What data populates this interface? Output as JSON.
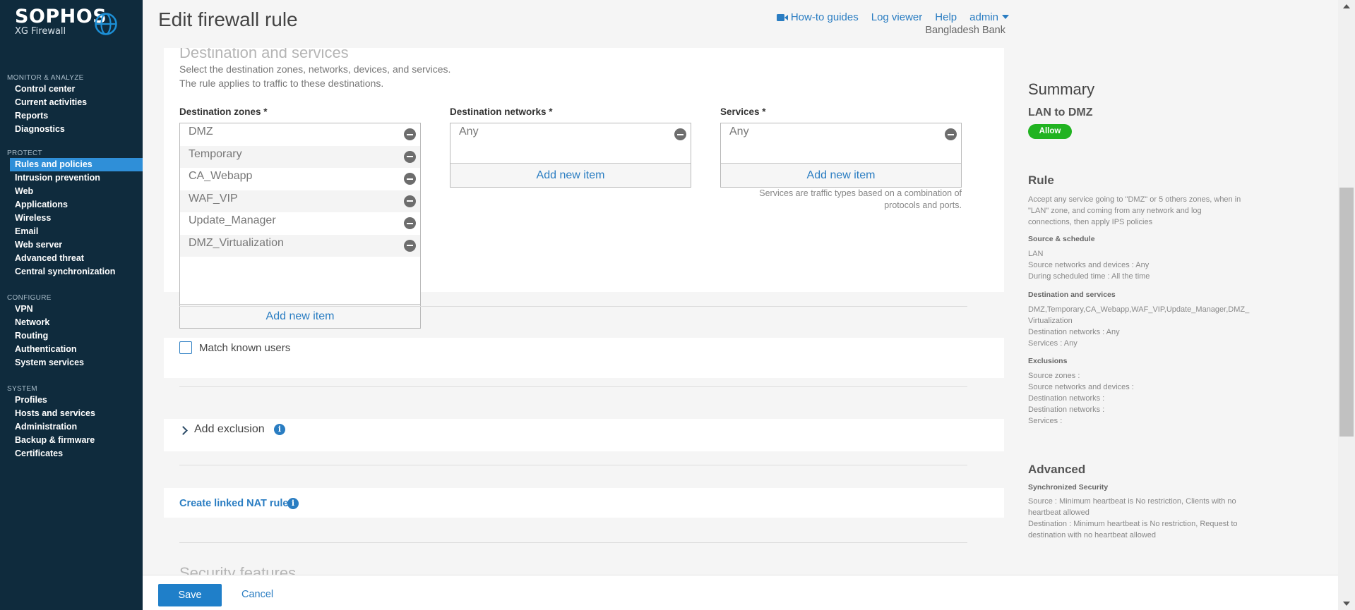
{
  "brand": {
    "name": "SOPHOS",
    "product": "XG Firewall"
  },
  "nav": [
    {
      "title": "MONITOR & ANALYZE",
      "items": [
        "Control center",
        "Current activities",
        "Reports",
        "Diagnostics"
      ]
    },
    {
      "title": "PROTECT",
      "items": [
        "Rules and policies",
        "Intrusion prevention",
        "Web",
        "Applications",
        "Wireless",
        "Email",
        "Web server",
        "Advanced threat",
        "Central synchronization"
      ]
    },
    {
      "title": "CONFIGURE",
      "items": [
        "VPN",
        "Network",
        "Routing",
        "Authentication",
        "System services"
      ]
    },
    {
      "title": "SYSTEM",
      "items": [
        "Profiles",
        "Hosts and services",
        "Administration",
        "Backup & firmware",
        "Certificates"
      ]
    }
  ],
  "active_nav": "Rules and policies",
  "header": {
    "title": "Edit firewall rule",
    "how_to": "How-to guides",
    "log_viewer": "Log viewer",
    "help": "Help",
    "user": "admin",
    "org": "Bangladesh Bank"
  },
  "destination": {
    "heading": "Destination and services",
    "desc1": "Select the destination zones, networks, devices, and services.",
    "desc2": "The rule applies to traffic to these destinations.",
    "zones_label": "Destination zones *",
    "zones": [
      "DMZ",
      "Temporary",
      "CA_Webapp",
      "WAF_VIP",
      "Update_Manager",
      "DMZ_Virtualization"
    ],
    "networks_label": "Destination networks *",
    "networks": [
      "Any"
    ],
    "services_label": "Services *",
    "services": [
      "Any"
    ],
    "add_item": "Add new item",
    "services_note1": "Services are traffic types based on a combination of",
    "services_note2": "protocols and ports."
  },
  "match_known_users": "Match known users",
  "add_exclusion": "Add exclusion",
  "linked_nat": "Create linked NAT rule",
  "security_heading": "Security features",
  "footer": {
    "save": "Save",
    "cancel": "Cancel"
  },
  "summary": {
    "title": "Summary",
    "rule_name": "LAN to DMZ",
    "action": "Allow",
    "rule_heading": "Rule",
    "rule_desc1": "Accept any service going to \"DMZ\" or 5 others zones, when in",
    "rule_desc2": "\"LAN\" zone, and coming from any network and log",
    "rule_desc3": "connections, then apply IPS policies",
    "source_heading": "Source & schedule",
    "source_zone": "LAN",
    "source_networks": "Source networks and devices : Any",
    "schedule": "During scheduled time : All the time",
    "dest_heading": "Destination and services",
    "dest_zones1": "DMZ,Temporary,CA_Webapp,WAF_VIP,Update_Manager,DMZ_",
    "dest_zones2": "Virtualization",
    "dest_networks": "Destination networks : Any",
    "dest_services": "Services : Any",
    "excl_heading": "Exclusions",
    "excl1": "Source zones :",
    "excl2": "Source networks and devices :",
    "excl3": "Destination networks :",
    "excl4": "Destination networks :",
    "excl5": "Services :",
    "adv_heading": "Advanced",
    "sync_heading": "Synchronized Security",
    "sync1": "Source : Minimum heartbeat is No restriction, Clients with no",
    "sync2": "heartbeat allowed",
    "sync3": "Destination : Minimum heartbeat is No restriction, Request to",
    "sync4": "destination with no heartbeat allowed"
  },
  "colors": {
    "sidebar": "#0f2b3d",
    "active": "#2f8fd8",
    "link": "#2a7dc2",
    "allow": "#21b321",
    "save": "#1f7fc9"
  },
  "icons": [
    "sophos-globe-icon",
    "video-camera-icon",
    "caret-down-icon",
    "remove-icon",
    "chevron-right-icon",
    "info-icon",
    "scroll-up-icon",
    "scroll-down-icon"
  ]
}
